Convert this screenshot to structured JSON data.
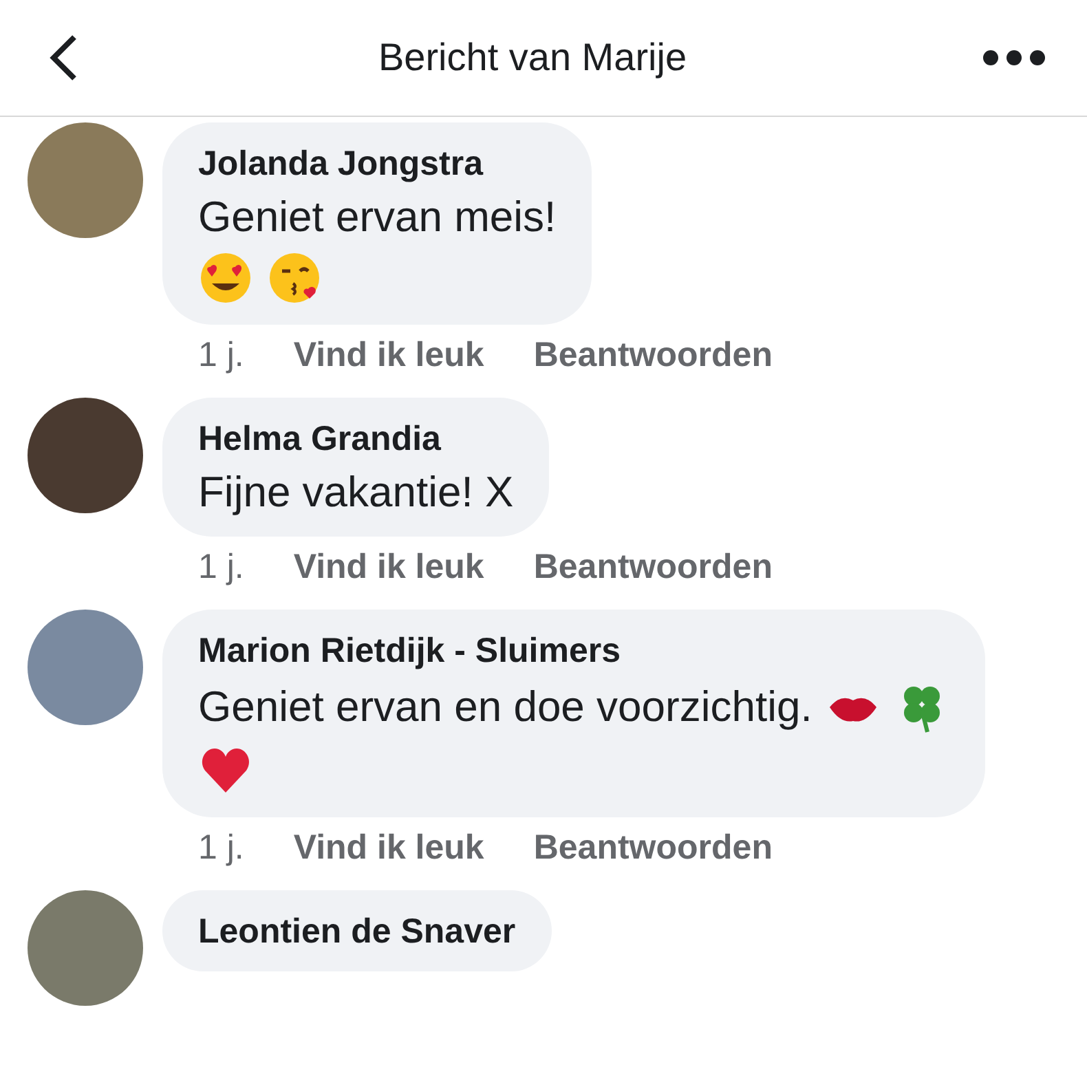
{
  "header": {
    "title": "Bericht van Marije"
  },
  "comments": [
    {
      "author": "Jolanda Jongstra",
      "lines": [
        {
          "text": "Geniet ervan meis!"
        },
        {
          "emojis": [
            {
              "kind": "heart_eyes"
            },
            {
              "kind": "kiss"
            }
          ]
        }
      ],
      "time": "1 j.",
      "like": "Vind ik leuk",
      "reply": "Beantwoorden"
    },
    {
      "author": "Helma Grandia",
      "lines": [
        {
          "text": "Fijne vakantie! X"
        }
      ],
      "time": "1 j.",
      "like": "Vind ik leuk",
      "reply": "Beantwoorden"
    },
    {
      "author": "Marion Rietdijk - Sluimers",
      "lines": [
        {
          "text": "Geniet ervan en doe voorzichtig.",
          "emojis": [
            {
              "kind": "lips"
            },
            {
              "kind": "clover"
            }
          ]
        },
        {
          "emojis": [
            {
              "kind": "heart"
            }
          ]
        }
      ],
      "time": "1 j.",
      "like": "Vind ik leuk",
      "reply": "Beantwoorden"
    },
    {
      "author": "Leontien de Snaver"
    }
  ]
}
